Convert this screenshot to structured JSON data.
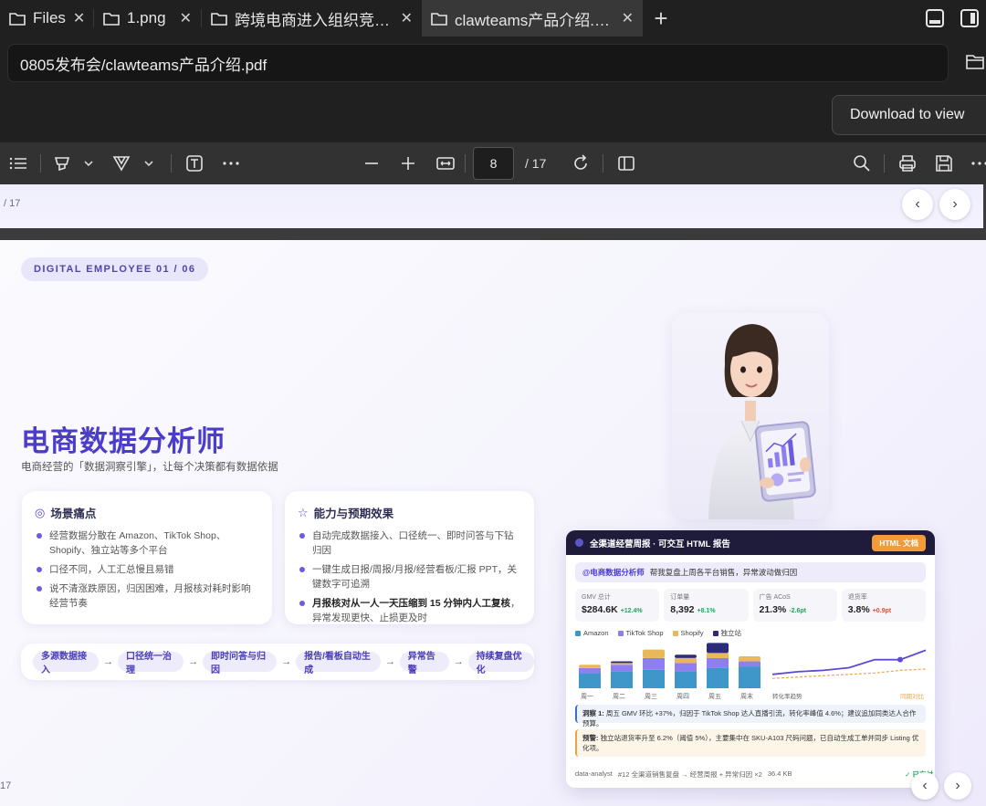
{
  "tabs": [
    {
      "label": "Files",
      "active": false
    },
    {
      "label": "1.png",
      "active": false
    },
    {
      "label": "跨境电商进入组织竞…",
      "active": false
    },
    {
      "label": "clawteams产品介绍.…",
      "active": true
    }
  ],
  "tab_close_glyph": "✕",
  "new_tab_glyph": "+",
  "address": {
    "value": "0805发布会/clawteams产品介绍.pdf"
  },
  "download_button": "Download to view",
  "pdf_toolbar": {
    "current_page": "8",
    "total_pages": "/ 17",
    "icons": [
      "list-icon",
      "highlighter-icon",
      "chevron-down-icon",
      "draw-icon",
      "chevron-down-icon",
      "text-box-icon",
      "more-icon",
      "zoom-out-icon",
      "zoom-in-icon",
      "fit-width-icon",
      "rotate-icon",
      "page-view-icon",
      "search-icon",
      "print-icon",
      "save-icon",
      "more-icon"
    ]
  },
  "prev_page": {
    "page_label": "/ 17"
  },
  "slide": {
    "badge": "DIGITAL EMPLOYEE 01 / 06",
    "title": "电商数据分析师",
    "subtitle": "电商经营的「数据洞察引擎」，让每个决策都有数据依据",
    "card_pain": {
      "title": "场景痛点",
      "items": [
        "经营数据分散在 Amazon、TikTok Shop、Shopify、独立站等多个平台",
        "口径不同，人工汇总慢且易错",
        "说不清涨跌原因，归因困难，月报核对耗时影响经营节奏"
      ]
    },
    "card_effect": {
      "title": "能力与预期效果",
      "items": [
        "自动完成数据接入、口径统一、即时问答与下钻归因",
        "一键生成日报/周报/月报/经营看板/汇报 PPT，关键数字可追溯"
      ],
      "item3_bold": "月报核对从一人一天压缩到 15 分钟内人工复核",
      "item3_rest": "，异常发现更快、止损更及时"
    },
    "flow": [
      "多源数据接入",
      "口径统一治理",
      "即时问答与归因",
      "报告/看板自动生成",
      "异常告警",
      "持续复盘优化"
    ],
    "flow_arrow": "→",
    "page_number": "17"
  },
  "report": {
    "header": "全渠道经营周报 · 可交互 HTML 报告",
    "tag": "HTML 文档",
    "prompt_mention": "@电商数据分析师",
    "prompt_text": "帮我复盘上周各平台销售，异常波动做归因",
    "kpis": [
      {
        "label": "GMV 总计",
        "value": "$284.6K",
        "delta": "+12.4%",
        "color": "#23a35a"
      },
      {
        "label": "订单量",
        "value": "8,392",
        "delta": "+8.1%",
        "color": "#23a35a"
      },
      {
        "label": "广告 ACoS",
        "value": "21.3%",
        "delta": "-2.6pt",
        "color": "#23a35a"
      },
      {
        "label": "退货率",
        "value": "3.8%",
        "delta": "+0.9pt",
        "color": "#e0503c"
      }
    ],
    "legend": [
      {
        "name": "Amazon",
        "color": "#3f97c9"
      },
      {
        "name": "TikTok Shop",
        "color": "#8e7ef0"
      },
      {
        "name": "Shopify",
        "color": "#e9b85a"
      },
      {
        "name": "独立站",
        "color": "#2c2c7a"
      }
    ],
    "insight1_label": "洞察 1:",
    "insight1_text": "周五 GMV 环比 +37%，归因于 TikTok Shop 达人直播引流，转化率峰值 4.6%；建议追加同类达人合作预算。",
    "insight2_label": "预警:",
    "insight2_text": "独立站退货率升至 6.2%（阈值 5%），主要集中在 SKU-A103 尺码问题，已自动生成工单并同步 Listing 优化项。",
    "footer": [
      "data-analyst",
      "#12 全渠道销售复盘 → 经营周报 + 异常归因 ×2",
      "36.4 KB"
    ],
    "footer_status": "✓ 已交付",
    "trend_label": "转化率趋势",
    "compare_label": "同期对比"
  },
  "chart_data": {
    "type": "bar",
    "stacked": true,
    "categories": [
      "周一",
      "周二",
      "周三",
      "周四",
      "周五",
      "周末"
    ],
    "series": [
      {
        "name": "Amazon",
        "values": [
          18,
          20,
          22,
          20,
          24,
          26
        ]
      },
      {
        "name": "TikTok Shop",
        "values": [
          6,
          8,
          14,
          10,
          12,
          6
        ]
      },
      {
        "name": "Shopify",
        "values": [
          4,
          2,
          10,
          6,
          6,
          6
        ]
      },
      {
        "name": "独立站",
        "values": [
          0,
          2,
          0,
          4,
          12,
          0
        ]
      }
    ],
    "line": {
      "values": [
        18,
        22,
        24,
        28,
        40,
        40,
        54
      ],
      "compare": [
        12,
        14,
        16,
        18,
        20,
        24,
        26
      ]
    }
  }
}
